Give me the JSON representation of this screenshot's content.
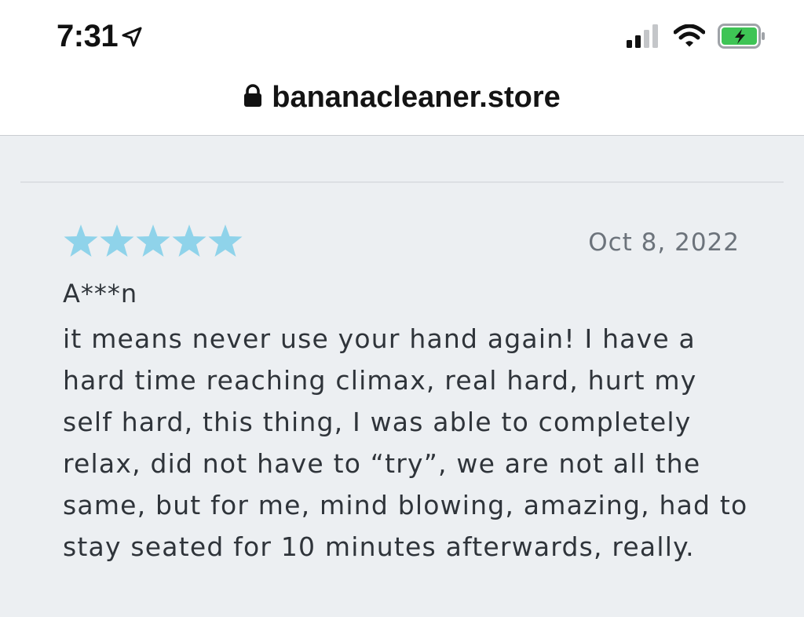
{
  "status_bar": {
    "time": "7:31",
    "icons": [
      "location-arrow-icon",
      "cellular-signal-icon",
      "wifi-icon",
      "battery-charging-icon"
    ],
    "battery_color": "#3ec455"
  },
  "url_bar": {
    "url": "bananacleaner.store",
    "lock_icon": "lock-icon"
  },
  "review": {
    "rating": 5,
    "star_color": "#8fd3ea",
    "date": "Oct 8, 2022",
    "reviewer": "A***n",
    "text": "it means never use your hand again! I have a hard time reaching climax, real hard, hurt my self hard, this thing, I was able to completely relax, did not have to “try”, we are not all the same, but for me, mind blowing, amazing, had to stay seated for 10 minutes afterwards, really."
  }
}
